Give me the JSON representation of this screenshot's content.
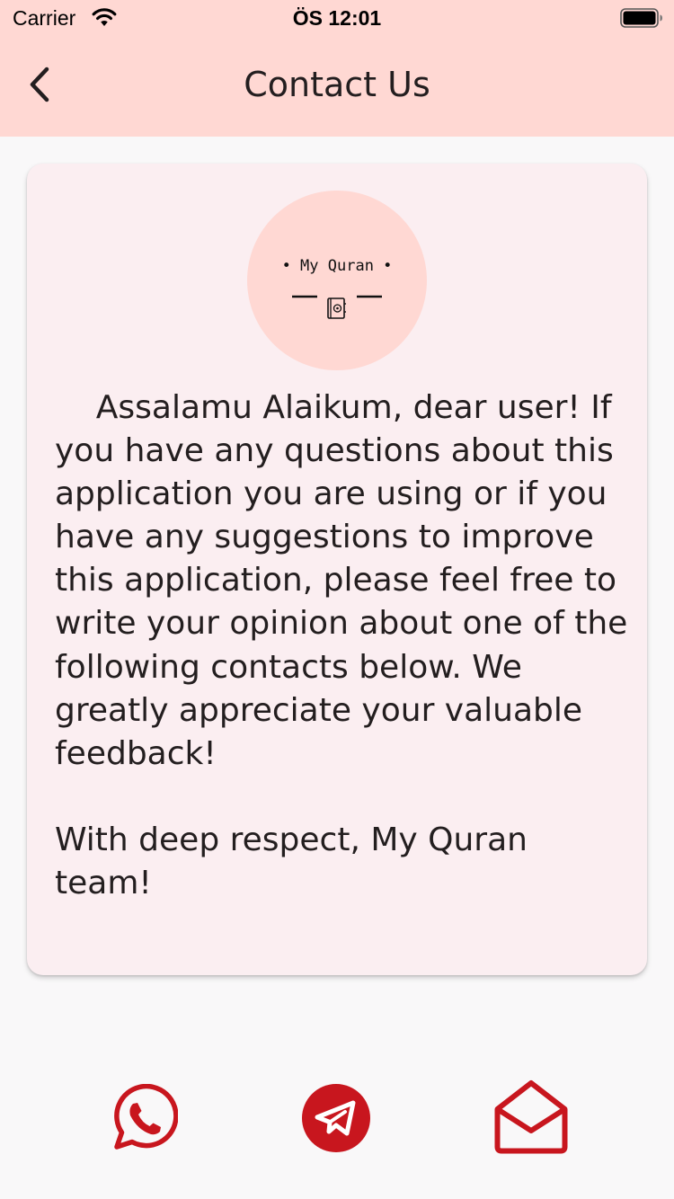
{
  "status_bar": {
    "carrier": "Carrier",
    "time": "ÖS 12:01"
  },
  "header": {
    "title": "Contact Us",
    "back_icon": "chevron-left-icon"
  },
  "card": {
    "logo": {
      "text": "• My Quran •",
      "icon": "book-icon"
    },
    "message": "    Assalamu Alaikum, dear user! If you have any questions about this application you are using or if you have any suggestions to improve this application, please feel free to write your opinion about one of the following contacts below. We greatly appreciate your valuable feedback!\n\nWith deep respect, My Quran team!"
  },
  "contacts": [
    {
      "icon": "whatsapp-icon"
    },
    {
      "icon": "telegram-icon"
    },
    {
      "icon": "email-icon"
    }
  ],
  "colors": {
    "header_bg": "#ffd8d3",
    "card_bg": "#fbeef1",
    "accent": "#c8161e",
    "page_bg": "#f9f8f9"
  }
}
